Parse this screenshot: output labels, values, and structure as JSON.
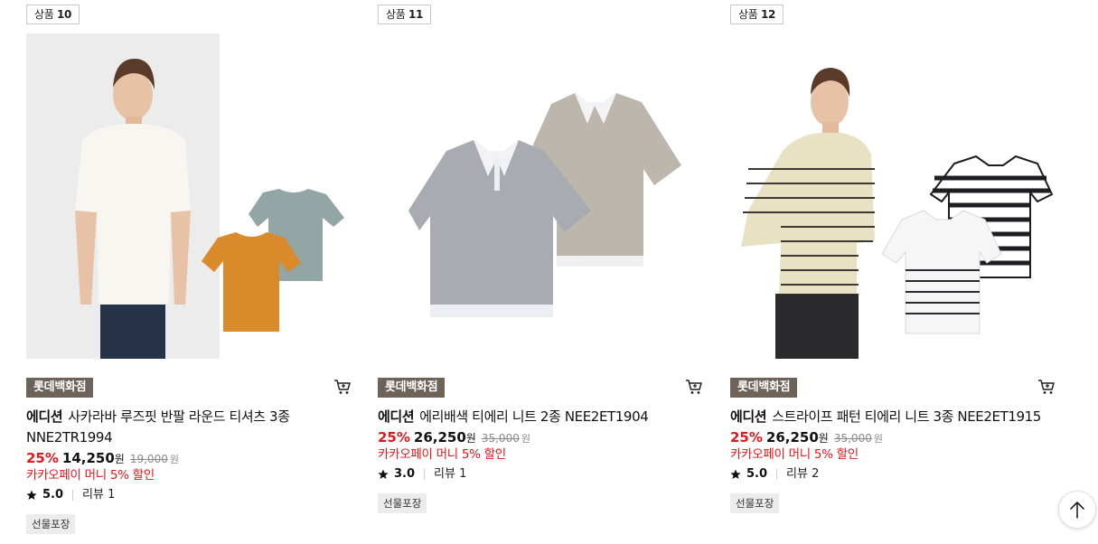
{
  "products": [
    {
      "badge_prefix": "상품",
      "badge_num": "10",
      "store": "롯데백화점",
      "brand": "에디션",
      "name": "사카라바 루즈핏 반팔 라운드 티셔츠 3종 NNE2TR1994",
      "discount": "25%",
      "price": "14,250",
      "price_unit": "원",
      "original_price": "19,000",
      "original_unit": "원",
      "promo": "카카오페이 머니 5% 할인",
      "rating": "5.0",
      "review": "리뷰 1",
      "gift": "선물포장",
      "image_icon": "tshirt-model-photo"
    },
    {
      "badge_prefix": "상품",
      "badge_num": "11",
      "store": "롯데백화점",
      "brand": "에디션",
      "name": "에리배색 티에리 니트 2종 NEE2ET1904",
      "discount": "25%",
      "price": "26,250",
      "price_unit": "원",
      "original_price": "35,000",
      "original_unit": "원",
      "promo": "카카오페이 머니 5% 할인",
      "rating": "3.0",
      "review": "리뷰 1",
      "gift": "선물포장",
      "image_icon": "polo-knit-photo"
    },
    {
      "badge_prefix": "상품",
      "badge_num": "12",
      "store": "롯데백화점",
      "brand": "에디션",
      "name": "스트라이프 패턴 티에리 니트 3종 NEE2ET1915",
      "discount": "25%",
      "price": "26,250",
      "price_unit": "원",
      "original_price": "35,000",
      "original_unit": "원",
      "promo": "카카오페이 머니 5% 할인",
      "rating": "5.0",
      "review": "리뷰 2",
      "gift": "선물포장",
      "image_icon": "stripe-polo-model-photo"
    }
  ],
  "colors": {
    "store_tag_bg": "#6e6359",
    "discount": "#e5161c",
    "gift_bg": "#ececec"
  },
  "icons": {
    "cart": "cart-icon",
    "star": "star-icon",
    "scroll_top": "arrow-up-icon"
  }
}
